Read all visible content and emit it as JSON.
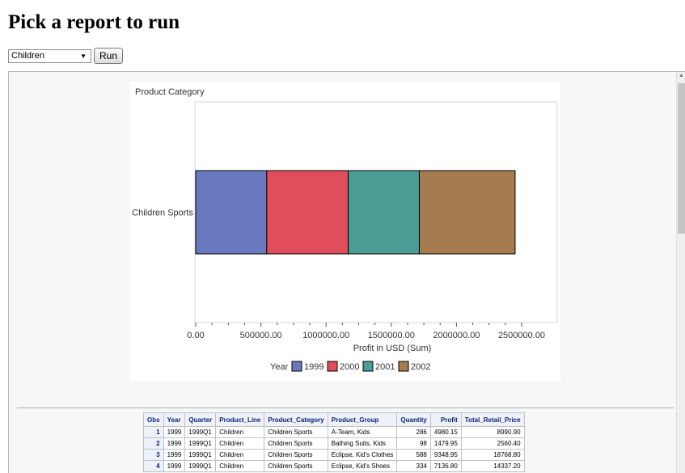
{
  "page": {
    "title": "Pick a report to run"
  },
  "controls": {
    "selected_report": "Children",
    "run_label": "Run"
  },
  "chart_data": {
    "type": "bar",
    "orientation": "horizontal",
    "stacked": true,
    "title": "Product Category",
    "categories": [
      "Children Sports"
    ],
    "series": [
      {
        "name": "1999",
        "values": [
          545000
        ],
        "color": "#6a78c0"
      },
      {
        "name": "2000",
        "values": [
          625000
        ],
        "color": "#e04e5c"
      },
      {
        "name": "2001",
        "values": [
          545000
        ],
        "color": "#4a9e96"
      },
      {
        "name": "2002",
        "values": [
          735000
        ],
        "color": "#a67c4e"
      }
    ],
    "xlabel": "Profit in USD (Sum)",
    "xlim": [
      0,
      2500000
    ],
    "xticks": [
      "0.00",
      "500000.00",
      "1000000.00",
      "1500000.00",
      "2000000.00",
      "2500000.00"
    ],
    "legend": {
      "title": "Year",
      "position": "bottom"
    },
    "grid": false
  },
  "table": {
    "columns": [
      "Obs",
      "Year",
      "Quarter",
      "Product_Line",
      "Product_Category",
      "Product_Group",
      "Quantity",
      "Profit",
      "Total_Retail_Price"
    ],
    "rows": [
      [
        "1",
        "1999",
        "1999Q1",
        "Children",
        "Children Sports",
        "A-Team, Kids",
        "286",
        "4980.15",
        "8990.90"
      ],
      [
        "2",
        "1999",
        "1999Q1",
        "Children",
        "Children Sports",
        "Bathing Suits, Kids",
        "98",
        "1479.95",
        "2560.40"
      ],
      [
        "3",
        "1999",
        "1999Q1",
        "Children",
        "Children Sports",
        "Eclipse, Kid's Clothes",
        "588",
        "9348.95",
        "18768.80"
      ],
      [
        "4",
        "1999",
        "1999Q1",
        "Children",
        "Children Sports",
        "Eclipse, Kid's Shoes",
        "334",
        "7136.80",
        "14337.20"
      ]
    ]
  },
  "icons": {
    "dropdown": "chevron-down-icon",
    "scroll_up": "scroll-up-arrow-icon"
  }
}
